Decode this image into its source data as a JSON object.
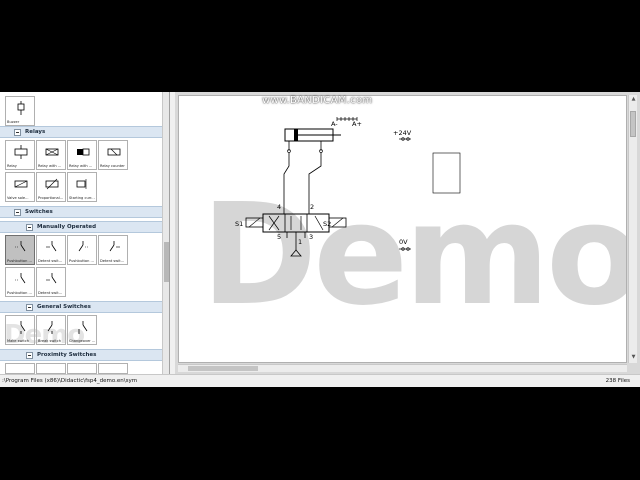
{
  "recorder_watermark": "www.BANDICAM.com",
  "library": {
    "top_tile": {
      "label": "Buzzer",
      "icon": "buzzer-icon"
    },
    "sections": [
      {
        "label": "Relays"
      },
      {
        "label": "Switches"
      },
      {
        "label": "Manually Operated"
      },
      {
        "label": "General Switches"
      },
      {
        "label": "Proximity Switches"
      }
    ],
    "relays": [
      {
        "label": "Relay",
        "icon": "relay-icon"
      },
      {
        "label": "Relay with ...",
        "icon": "relay-with-icon"
      },
      {
        "label": "Relay with ...",
        "icon": "relay-with-icon"
      },
      {
        "label": "Relay counter",
        "icon": "relay-counter-icon"
      },
      {
        "label": "Valve sole...",
        "icon": "valve-solenoid-icon"
      },
      {
        "label": "Proportional...",
        "icon": "proportional-icon"
      },
      {
        "label": "Starting curr...",
        "icon": "starting-current-icon"
      }
    ],
    "manual": [
      {
        "label": "Pushbutton ...",
        "icon": "pushbutton-icon",
        "selected": true
      },
      {
        "label": "Detent swit...",
        "icon": "detent-switch-icon"
      },
      {
        "label": "Pushbutton ...",
        "icon": "pushbutton-icon"
      },
      {
        "label": "Detent swit...",
        "icon": "detent-switch-icon"
      },
      {
        "label": "Pushbutton ...",
        "icon": "pushbutton-icon"
      },
      {
        "label": "Detent swit...",
        "icon": "detent-switch-icon"
      }
    ],
    "general": [
      {
        "label": "Make switch",
        "icon": "make-switch-icon"
      },
      {
        "label": "Break switch",
        "icon": "break-switch-icon"
      },
      {
        "label": "Changeover ...",
        "icon": "changeover-icon"
      }
    ],
    "watermark": "Demo"
  },
  "canvas": {
    "watermark": "Demo",
    "cylinder_labels": {
      "minus": "A-",
      "plus": "A+"
    },
    "valve_ports": {
      "p4": "4",
      "p2": "2",
      "p5": "5",
      "p1": "1",
      "p3": "3"
    },
    "solenoids": {
      "s1": "S1",
      "s2": "S2"
    },
    "supply_plus": "+24V",
    "supply_zero": "0V"
  },
  "status": {
    "path": ":\\Program Files (x86)\\Didactic\\fsp4_demo.en\\sym",
    "files": "238 Files"
  }
}
